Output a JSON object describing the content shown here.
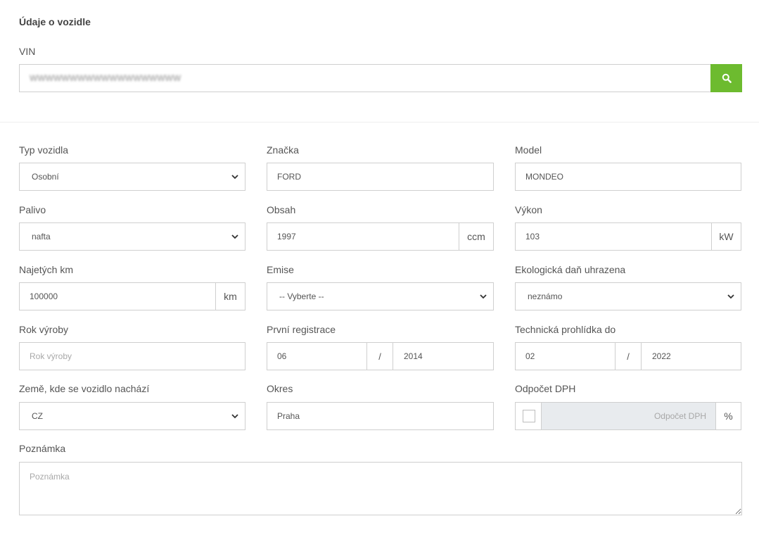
{
  "section_title": "Údaje o vozidle",
  "vin": {
    "label": "VIN",
    "value": "WWWWWWWWWWWWWWWWWWW"
  },
  "colors": {
    "accent": "#6dbb2f",
    "border": "#cfcfcf",
    "disabled_bg": "#e8ebee"
  },
  "icons": {
    "search": "search-icon",
    "dropdown": "chevron-down-icon"
  },
  "fields": {
    "typ_vozidla": {
      "label": "Typ vozidla",
      "value": "Osobní"
    },
    "znacka": {
      "label": "Značka",
      "value": "FORD"
    },
    "model": {
      "label": "Model",
      "value": "MONDEO"
    },
    "palivo": {
      "label": "Palivo",
      "value": "nafta"
    },
    "obsah": {
      "label": "Obsah",
      "value": "1997",
      "unit": "ccm"
    },
    "vykon": {
      "label": "Výkon",
      "value": "103",
      "unit": "kW"
    },
    "najete_km": {
      "label": "Najetých km",
      "value": "100000",
      "unit": "km"
    },
    "emise": {
      "label": "Emise",
      "value": "-- Vyberte --"
    },
    "eko_dan": {
      "label": "Ekologická daň uhrazena",
      "value": "neznámo"
    },
    "rok_vyroby": {
      "label": "Rok výroby",
      "placeholder": "Rok výroby"
    },
    "prvni_registrace": {
      "label": "První registrace",
      "month": "06",
      "separator": "/",
      "year": "2014"
    },
    "stk_do": {
      "label": "Technická prohlídka do",
      "month": "02",
      "separator": "/",
      "year": "2022"
    },
    "zeme": {
      "label": "Země, kde se vozidlo nachází",
      "value": "CZ"
    },
    "okres": {
      "label": "Okres",
      "value": "Praha"
    },
    "odpocet_dph": {
      "label": "Odpočet DPH",
      "placeholder": "Odpočet DPH",
      "unit": "%"
    },
    "poznamka": {
      "label": "Poznámka",
      "placeholder": "Poznámka"
    }
  }
}
